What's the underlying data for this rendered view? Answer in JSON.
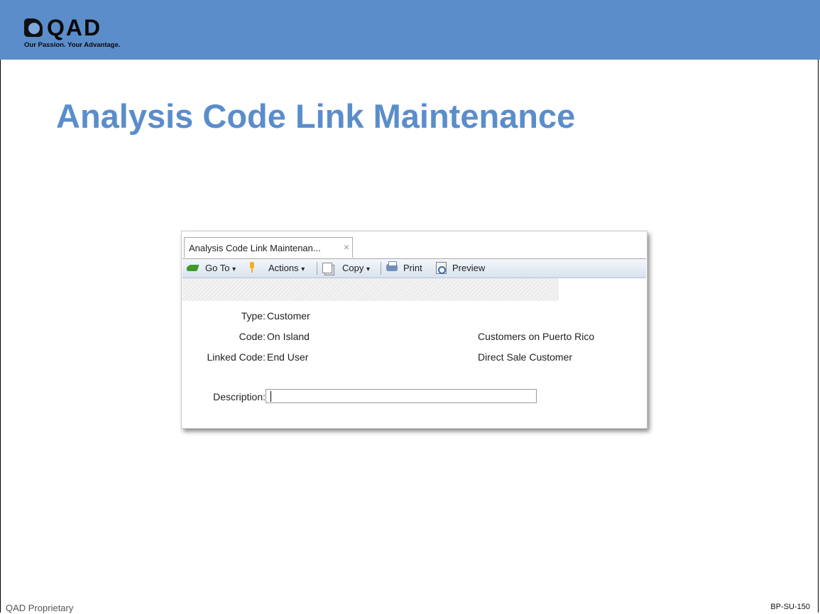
{
  "header": {
    "logo_text": "QAD",
    "tagline": "Our Passion. Your Advantage."
  },
  "page_title": "Analysis Code Link Maintenance",
  "app_window": {
    "tab_label": "Analysis Code Link Maintenan...",
    "tab_close": "×",
    "toolbar": {
      "goto_label": "Go To",
      "actions_label": "Actions",
      "copy_label": "Copy",
      "print_label": "Print",
      "preview_label": "Preview",
      "dropdown_arrow": "▾"
    },
    "form": {
      "type_label": "Type:",
      "type_value": "Customer",
      "code_label": "Code:",
      "code_value": "On Island",
      "code_description": "Customers on Puerto Rico",
      "linked_code_label": "Linked Code:",
      "linked_code_value": "End User",
      "linked_code_description": "Direct Sale Customer",
      "description_label": "Description:",
      "description_value": ""
    }
  },
  "footer": {
    "left": "QAD Proprietary",
    "right": "BP-SU-150"
  },
  "colors": {
    "brand_blue": "#5b8dcb"
  }
}
